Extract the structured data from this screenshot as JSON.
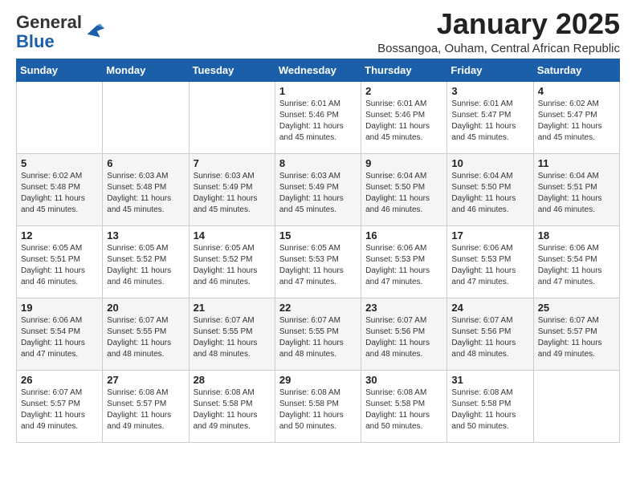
{
  "header": {
    "logo_general": "General",
    "logo_blue": "Blue",
    "title": "January 2025",
    "subtitle": "Bossangoa, Ouham, Central African Republic"
  },
  "weekdays": [
    "Sunday",
    "Monday",
    "Tuesday",
    "Wednesday",
    "Thursday",
    "Friday",
    "Saturday"
  ],
  "weeks": [
    [
      {
        "day": "",
        "info": ""
      },
      {
        "day": "",
        "info": ""
      },
      {
        "day": "",
        "info": ""
      },
      {
        "day": "1",
        "info": "Sunrise: 6:01 AM\nSunset: 5:46 PM\nDaylight: 11 hours\nand 45 minutes."
      },
      {
        "day": "2",
        "info": "Sunrise: 6:01 AM\nSunset: 5:46 PM\nDaylight: 11 hours\nand 45 minutes."
      },
      {
        "day": "3",
        "info": "Sunrise: 6:01 AM\nSunset: 5:47 PM\nDaylight: 11 hours\nand 45 minutes."
      },
      {
        "day": "4",
        "info": "Sunrise: 6:02 AM\nSunset: 5:47 PM\nDaylight: 11 hours\nand 45 minutes."
      }
    ],
    [
      {
        "day": "5",
        "info": "Sunrise: 6:02 AM\nSunset: 5:48 PM\nDaylight: 11 hours\nand 45 minutes."
      },
      {
        "day": "6",
        "info": "Sunrise: 6:03 AM\nSunset: 5:48 PM\nDaylight: 11 hours\nand 45 minutes."
      },
      {
        "day": "7",
        "info": "Sunrise: 6:03 AM\nSunset: 5:49 PM\nDaylight: 11 hours\nand 45 minutes."
      },
      {
        "day": "8",
        "info": "Sunrise: 6:03 AM\nSunset: 5:49 PM\nDaylight: 11 hours\nand 45 minutes."
      },
      {
        "day": "9",
        "info": "Sunrise: 6:04 AM\nSunset: 5:50 PM\nDaylight: 11 hours\nand 46 minutes."
      },
      {
        "day": "10",
        "info": "Sunrise: 6:04 AM\nSunset: 5:50 PM\nDaylight: 11 hours\nand 46 minutes."
      },
      {
        "day": "11",
        "info": "Sunrise: 6:04 AM\nSunset: 5:51 PM\nDaylight: 11 hours\nand 46 minutes."
      }
    ],
    [
      {
        "day": "12",
        "info": "Sunrise: 6:05 AM\nSunset: 5:51 PM\nDaylight: 11 hours\nand 46 minutes."
      },
      {
        "day": "13",
        "info": "Sunrise: 6:05 AM\nSunset: 5:52 PM\nDaylight: 11 hours\nand 46 minutes."
      },
      {
        "day": "14",
        "info": "Sunrise: 6:05 AM\nSunset: 5:52 PM\nDaylight: 11 hours\nand 46 minutes."
      },
      {
        "day": "15",
        "info": "Sunrise: 6:05 AM\nSunset: 5:53 PM\nDaylight: 11 hours\nand 47 minutes."
      },
      {
        "day": "16",
        "info": "Sunrise: 6:06 AM\nSunset: 5:53 PM\nDaylight: 11 hours\nand 47 minutes."
      },
      {
        "day": "17",
        "info": "Sunrise: 6:06 AM\nSunset: 5:53 PM\nDaylight: 11 hours\nand 47 minutes."
      },
      {
        "day": "18",
        "info": "Sunrise: 6:06 AM\nSunset: 5:54 PM\nDaylight: 11 hours\nand 47 minutes."
      }
    ],
    [
      {
        "day": "19",
        "info": "Sunrise: 6:06 AM\nSunset: 5:54 PM\nDaylight: 11 hours\nand 47 minutes."
      },
      {
        "day": "20",
        "info": "Sunrise: 6:07 AM\nSunset: 5:55 PM\nDaylight: 11 hours\nand 48 minutes."
      },
      {
        "day": "21",
        "info": "Sunrise: 6:07 AM\nSunset: 5:55 PM\nDaylight: 11 hours\nand 48 minutes."
      },
      {
        "day": "22",
        "info": "Sunrise: 6:07 AM\nSunset: 5:55 PM\nDaylight: 11 hours\nand 48 minutes."
      },
      {
        "day": "23",
        "info": "Sunrise: 6:07 AM\nSunset: 5:56 PM\nDaylight: 11 hours\nand 48 minutes."
      },
      {
        "day": "24",
        "info": "Sunrise: 6:07 AM\nSunset: 5:56 PM\nDaylight: 11 hours\nand 48 minutes."
      },
      {
        "day": "25",
        "info": "Sunrise: 6:07 AM\nSunset: 5:57 PM\nDaylight: 11 hours\nand 49 minutes."
      }
    ],
    [
      {
        "day": "26",
        "info": "Sunrise: 6:07 AM\nSunset: 5:57 PM\nDaylight: 11 hours\nand 49 minutes."
      },
      {
        "day": "27",
        "info": "Sunrise: 6:08 AM\nSunset: 5:57 PM\nDaylight: 11 hours\nand 49 minutes."
      },
      {
        "day": "28",
        "info": "Sunrise: 6:08 AM\nSunset: 5:58 PM\nDaylight: 11 hours\nand 49 minutes."
      },
      {
        "day": "29",
        "info": "Sunrise: 6:08 AM\nSunset: 5:58 PM\nDaylight: 11 hours\nand 50 minutes."
      },
      {
        "day": "30",
        "info": "Sunrise: 6:08 AM\nSunset: 5:58 PM\nDaylight: 11 hours\nand 50 minutes."
      },
      {
        "day": "31",
        "info": "Sunrise: 6:08 AM\nSunset: 5:58 PM\nDaylight: 11 hours\nand 50 minutes."
      },
      {
        "day": "",
        "info": ""
      }
    ]
  ]
}
